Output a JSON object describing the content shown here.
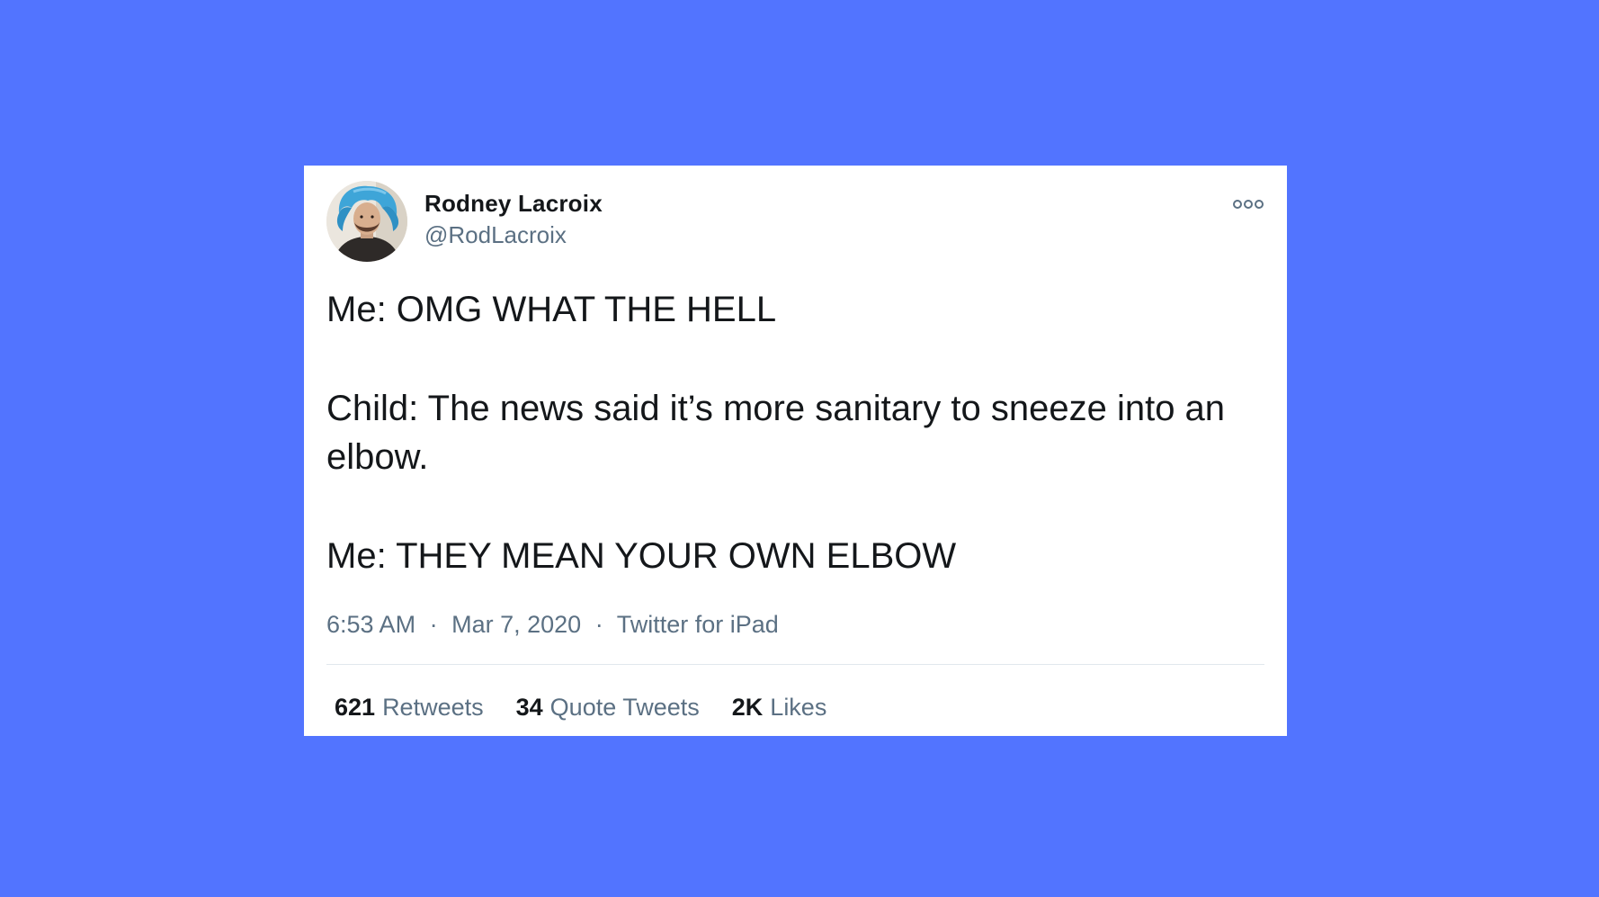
{
  "tweet": {
    "author": {
      "display_name": "Rodney Lacroix",
      "handle": "@RodLacroix"
    },
    "more_icon": "more-horizontal-icon",
    "lines": [
      "Me: OMG WHAT THE HELL",
      "Child: The news said it’s more sanitary to sneeze into an elbow.",
      "Me: THEY MEAN YOUR OWN ELBOW"
    ],
    "meta": {
      "time": "6:53 AM",
      "date": "Mar 7, 2020",
      "source": "Twitter for iPad",
      "separator": "·"
    },
    "stats": {
      "retweets": {
        "count": "621",
        "label": "Retweets"
      },
      "quote_tweets": {
        "count": "34",
        "label": "Quote Tweets"
      },
      "likes": {
        "count": "2K",
        "label": "Likes"
      }
    }
  },
  "colors": {
    "background": "#5274ff",
    "card": "#ffffff",
    "text_primary": "#14171a",
    "text_secondary": "#5b7083"
  }
}
